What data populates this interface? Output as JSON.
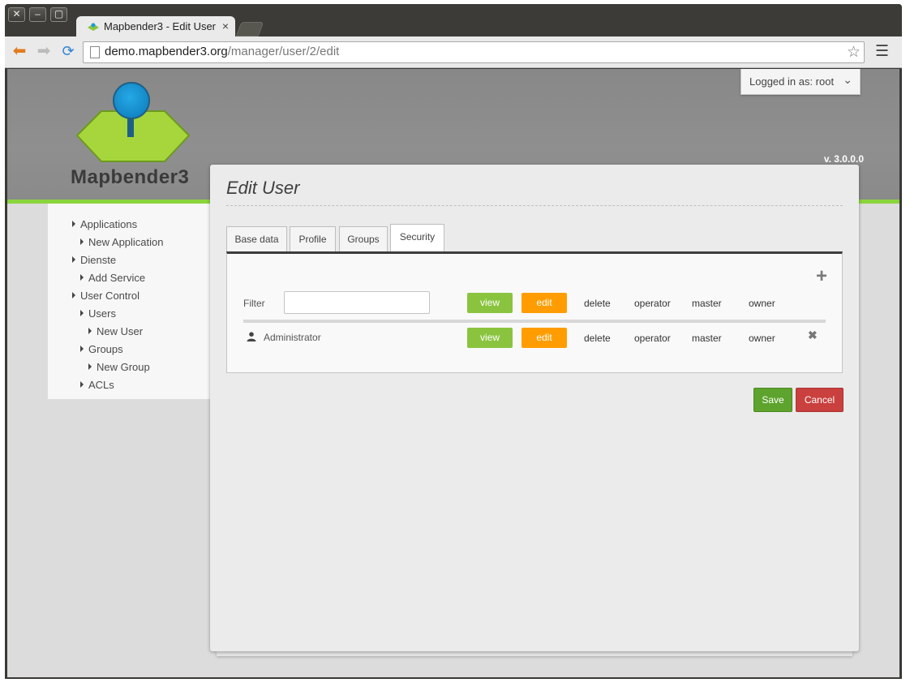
{
  "browser": {
    "tab_title": "Mapbender3 - Edit User",
    "url_host": "demo.mapbender3.org",
    "url_path": "/manager/user/2/edit",
    "icons": [
      "close-icon",
      "minimize-icon",
      "maximize-icon",
      "back-icon",
      "forward-icon",
      "reload-icon",
      "bookmark-star-icon",
      "menu-icon"
    ]
  },
  "header": {
    "logo_text": "Mapbender3",
    "version": "v. 3.0.0.0",
    "login_label": "Logged in as: root"
  },
  "sidebar": {
    "items": [
      {
        "label": "Applications"
      },
      {
        "label": "New Application"
      },
      {
        "label": "Dienste"
      },
      {
        "label": "Add Service"
      },
      {
        "label": "User Control"
      },
      {
        "label": "Users"
      },
      {
        "label": "New User"
      },
      {
        "label": "Groups"
      },
      {
        "label": "New Group"
      },
      {
        "label": "ACLs"
      }
    ]
  },
  "main": {
    "title": "Edit User",
    "tabs": [
      {
        "label": "Base data"
      },
      {
        "label": "Profile"
      },
      {
        "label": "Groups"
      },
      {
        "label": "Security",
        "active": true
      }
    ],
    "security": {
      "filter_label": "Filter",
      "filter_value": "",
      "header": {
        "view": "view",
        "edit": "edit",
        "delete": "delete",
        "operator": "operator",
        "master": "master",
        "owner": "owner"
      },
      "rows": [
        {
          "name": "Administrator",
          "view": "view",
          "edit": "edit",
          "delete": "delete",
          "operator": "operator",
          "master": "master",
          "owner": "owner"
        }
      ]
    },
    "save_label": "Save",
    "cancel_label": "Cancel"
  },
  "colors": {
    "view_green": "#8ac43f",
    "edit_orange": "#ff9d00",
    "save_green": "#5da32d",
    "cancel_red": "#c9403f",
    "header_accent": "#8bd43d"
  }
}
